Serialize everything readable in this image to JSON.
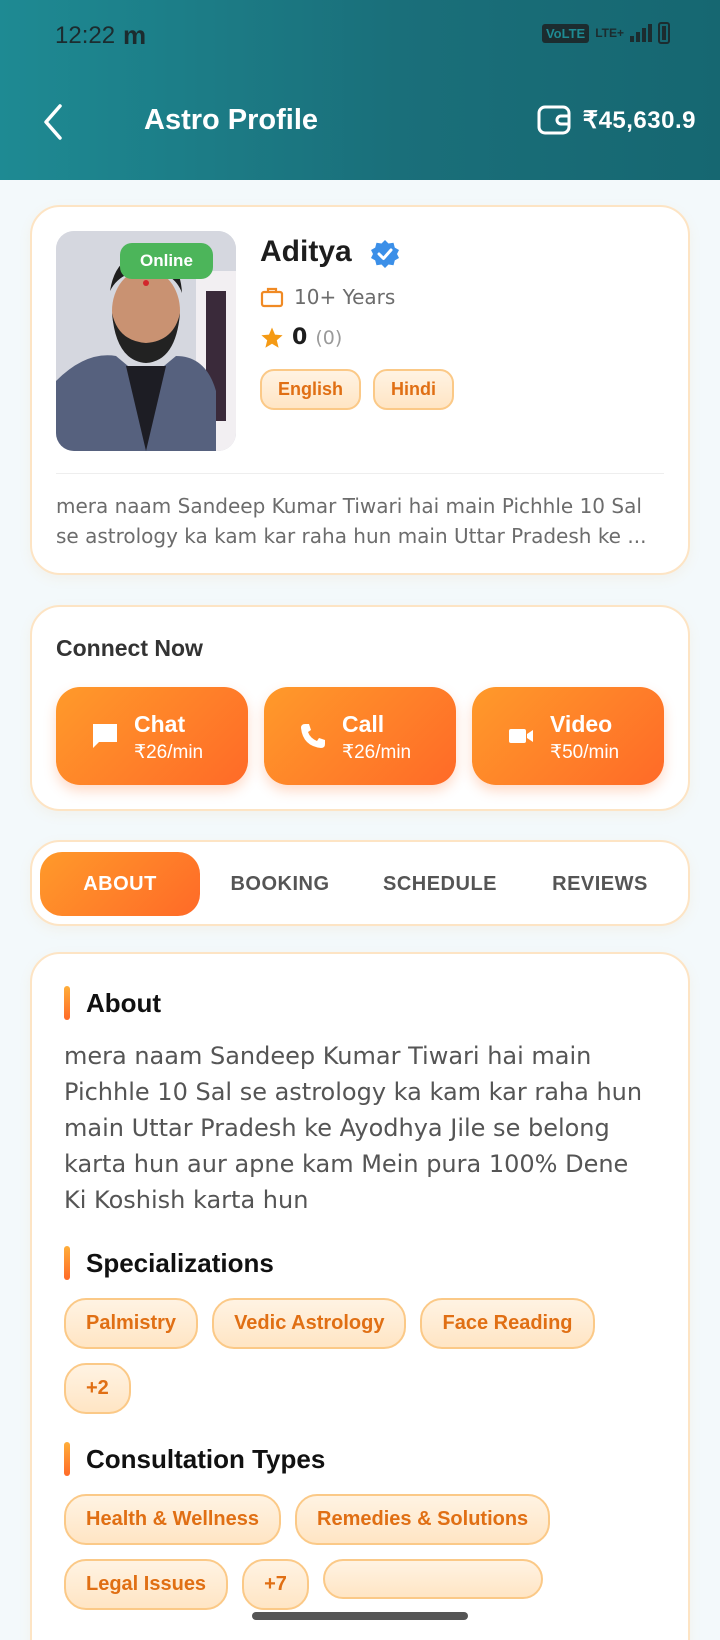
{
  "status_bar": {
    "time": "12:22",
    "carrier_glyph": "m",
    "volte": "VoLTE",
    "lte": "LTE+"
  },
  "header": {
    "title": "Astro Profile",
    "wallet_amount": "₹45,630.9"
  },
  "profile": {
    "online_label": "Online",
    "name": "Aditya",
    "experience": "10+ Years",
    "rating": "0",
    "rating_count": "(0)",
    "languages": [
      "English",
      "Hindi"
    ],
    "bio_short": "mera naam Sandeep Kumar Tiwari hai main Pichhle 10 Sal se astrology ka kam kar raha hun main Uttar Pradesh ke ..."
  },
  "connect": {
    "title": "Connect Now",
    "chat": {
      "label": "Chat",
      "price": "₹26/min"
    },
    "call": {
      "label": "Call",
      "price": "₹26/min"
    },
    "video": {
      "label": "Video",
      "price": "₹50/min"
    }
  },
  "tabs": [
    {
      "label": "ABOUT",
      "active": true
    },
    {
      "label": "BOOKING",
      "active": false
    },
    {
      "label": "SCHEDULE",
      "active": false
    },
    {
      "label": "REVIEWS",
      "active": false
    }
  ],
  "about": {
    "title": "About",
    "text": "mera naam Sandeep Kumar Tiwari hai main Pichhle 10 Sal se astrology ka kam kar raha hun main Uttar Pradesh ke Ayodhya Jile se belong karta hun aur apne kam Mein pura 100% Dene Ki Koshish karta hun",
    "specializations_title": "Specializations",
    "specializations": [
      "Palmistry",
      "Vedic Astrology",
      "Face Reading",
      "+2"
    ],
    "consultation_title": "Consultation Types",
    "consultations": [
      "Health & Wellness",
      "Remedies & Solutions",
      "Legal Issues",
      "+7"
    ]
  },
  "colors": {
    "header": "#1a6f7a",
    "accent": "#ff7a28",
    "online": "#4cb55a",
    "verified": "#3b8fe8"
  }
}
